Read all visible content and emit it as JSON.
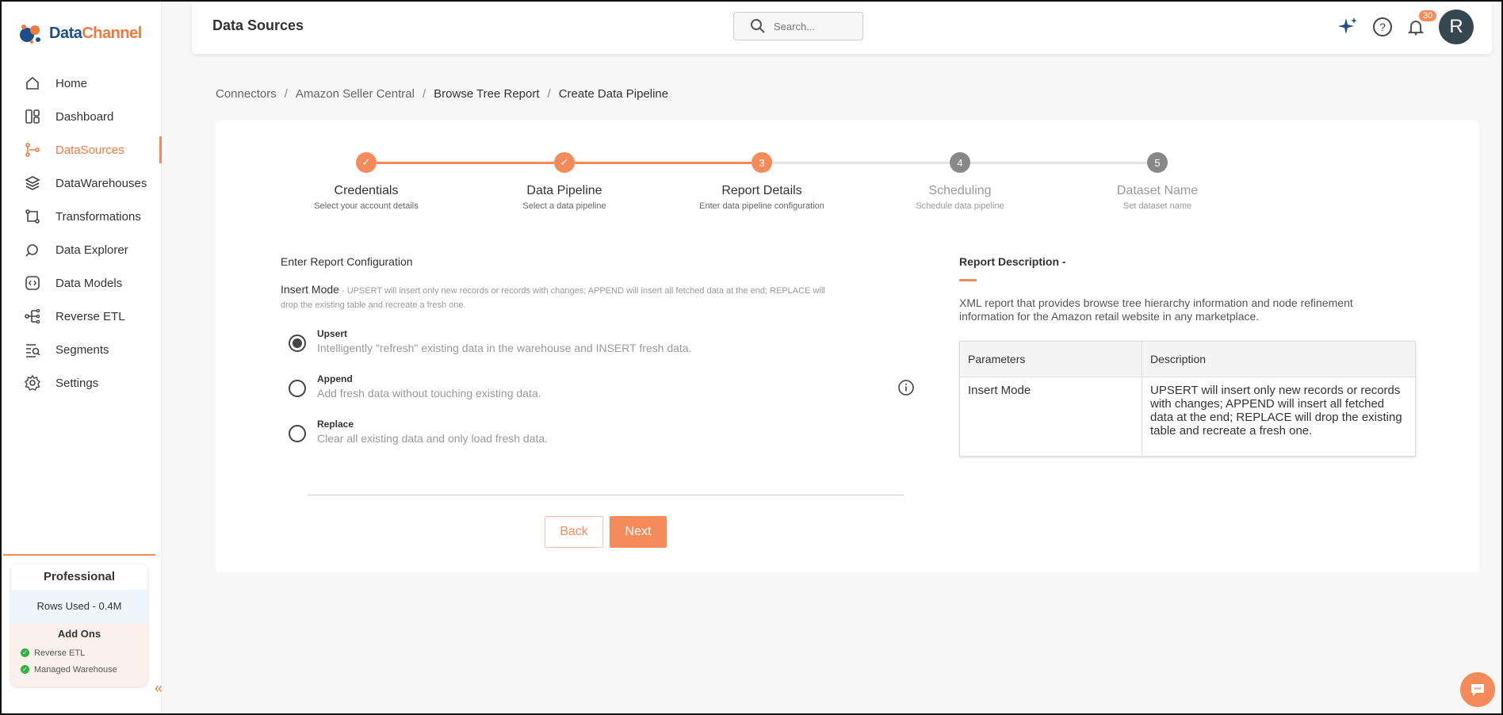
{
  "brand": {
    "name_part1": "Data",
    "name_part2": "Channel"
  },
  "sidebar": {
    "items": [
      {
        "label": "Home",
        "icon": "home-icon",
        "active": false
      },
      {
        "label": "Dashboard",
        "icon": "dashboard-icon",
        "active": false
      },
      {
        "label": "DataSources",
        "icon": "datasources-icon",
        "active": true
      },
      {
        "label": "DataWarehouses",
        "icon": "layers-icon",
        "active": false
      },
      {
        "label": "Transformations",
        "icon": "transform-icon",
        "active": false
      },
      {
        "label": "Data Explorer",
        "icon": "explorer-icon",
        "active": false
      },
      {
        "label": "Data Models",
        "icon": "models-icon",
        "active": false
      },
      {
        "label": "Reverse ETL",
        "icon": "reverse-etl-icon",
        "active": false
      },
      {
        "label": "Segments",
        "icon": "segments-icon",
        "active": false
      },
      {
        "label": "Settings",
        "icon": "gear-icon",
        "active": false
      }
    ],
    "plan": {
      "title": "Professional",
      "rows_used": "Rows Used - 0.4M",
      "addons_title": "Add Ons",
      "addons": [
        "Reverse ETL",
        "Managed Warehouse"
      ]
    }
  },
  "header": {
    "title": "Data Sources",
    "search_placeholder": "Search...",
    "notification_count": "30",
    "avatar_initial": "R"
  },
  "breadcrumb": {
    "items": [
      "Connectors",
      "Amazon Seller Central",
      "Browse Tree Report",
      "Create Data Pipeline"
    ],
    "separator": "/"
  },
  "stepper": {
    "steps": [
      {
        "number": "1",
        "title": "Credentials",
        "subtitle": "Select your account details",
        "state": "done"
      },
      {
        "number": "2",
        "title": "Data Pipeline",
        "subtitle": "Select a data pipeline",
        "state": "done"
      },
      {
        "number": "3",
        "title": "Report Details",
        "subtitle": "Enter data pipeline configuration",
        "state": "current"
      },
      {
        "number": "4",
        "title": "Scheduling",
        "subtitle": "Schedule data pipeline",
        "state": "pending"
      },
      {
        "number": "5",
        "title": "Dataset Name",
        "subtitle": "Set dataset name",
        "state": "pending"
      }
    ]
  },
  "config": {
    "section_title": "Enter Report Configuration",
    "insert_mode_label": "Insert Mode",
    "insert_mode_help": "- UPSERT will insert only new records or records with changes; APPEND will insert all fetched data at the end; REPLACE will drop the existing table and recreate a fresh one.",
    "options": [
      {
        "label": "Upsert",
        "desc": "Intelligently \"refresh\" existing data in the warehouse and INSERT fresh data.",
        "selected": true
      },
      {
        "label": "Append",
        "desc": "Add fresh data without touching existing data.",
        "selected": false
      },
      {
        "label": "Replace",
        "desc": "Clear all existing data and only load fresh data.",
        "selected": false
      }
    ],
    "back_label": "Back",
    "next_label": "Next"
  },
  "description": {
    "title": "Report Description -",
    "text": "XML report that provides browse tree hierarchy information and node refinement information for the Amazon retail website in any marketplace.",
    "table_headers": [
      "Parameters",
      "Description"
    ],
    "rows": [
      {
        "param": "Insert Mode",
        "desc": "UPSERT will insert only new records or records with changes; APPEND will insert all fetched data at the end; REPLACE will drop the existing table and recreate a fresh one."
      }
    ]
  },
  "colors": {
    "accent": "#f58b5a",
    "step_pending": "#888888",
    "brand_blue": "#1d4e89"
  }
}
